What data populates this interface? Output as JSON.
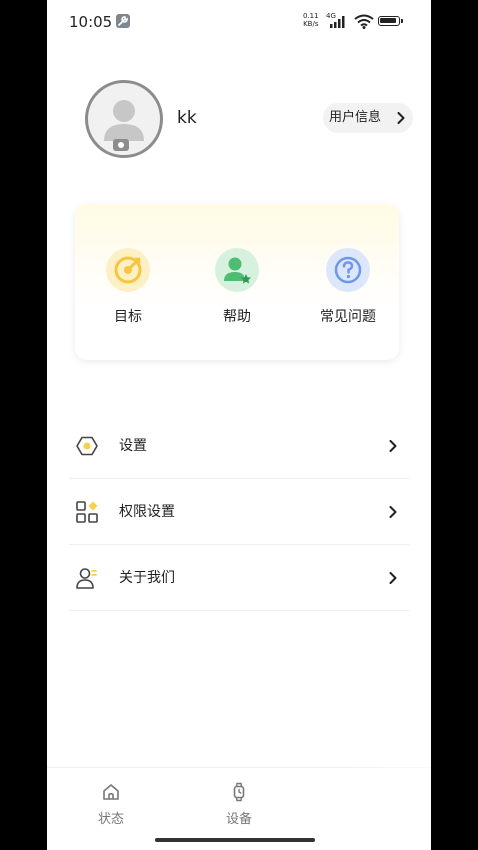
{
  "status_bar": {
    "time": "10:05",
    "net_speed_value": "0.11",
    "net_speed_unit": "KB/s",
    "network_type": "4G"
  },
  "profile": {
    "username": "kk",
    "user_info_label": "用户信息"
  },
  "quick_actions": [
    {
      "label": "目标",
      "icon": "target-icon",
      "color": "#f6c63f",
      "bg": "#fdf0c4"
    },
    {
      "label": "帮助",
      "icon": "user-star-icon",
      "color": "#4ebc73",
      "bg": "#d6f1dd"
    },
    {
      "label": "常见问题",
      "icon": "question-icon",
      "color": "#6d97e8",
      "bg": "#dce7fb"
    }
  ],
  "menu": [
    {
      "label": "设置",
      "icon": "hexagon-settings-icon"
    },
    {
      "label": "权限设置",
      "icon": "grid-apps-icon"
    },
    {
      "label": "关于我们",
      "icon": "about-person-icon"
    }
  ],
  "bottom_nav": [
    {
      "label": "状态",
      "icon": "home-icon"
    },
    {
      "label": "设备",
      "icon": "watch-icon"
    }
  ]
}
